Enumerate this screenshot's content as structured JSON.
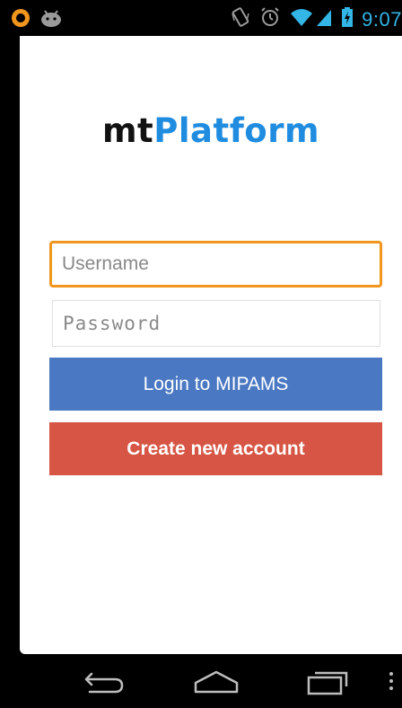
{
  "status_bar": {
    "time": "9:07",
    "left_icons": [
      "notification-app-icon",
      "android-debug-icon"
    ],
    "right_icons": [
      "vibrate-icon",
      "alarm-icon",
      "wifi-icon",
      "signal-icon",
      "battery-charging-icon"
    ],
    "accent_color": "#33b5e5"
  },
  "app": {
    "logo_prefix": "mt",
    "logo_suffix": "Platform",
    "logo_prefix_color": "#111111",
    "logo_suffix_color": "#1f8ce0"
  },
  "form": {
    "username_placeholder": "Username",
    "password_placeholder": "Password",
    "login_label": "Login to MIPAMS",
    "create_label": "Create new account",
    "focus_color": "#f0961d",
    "login_color": "#4a78c2",
    "create_color": "#d65544"
  },
  "nav_bar": {
    "items": [
      "back-icon",
      "home-icon",
      "recents-icon",
      "menu-icon"
    ]
  }
}
